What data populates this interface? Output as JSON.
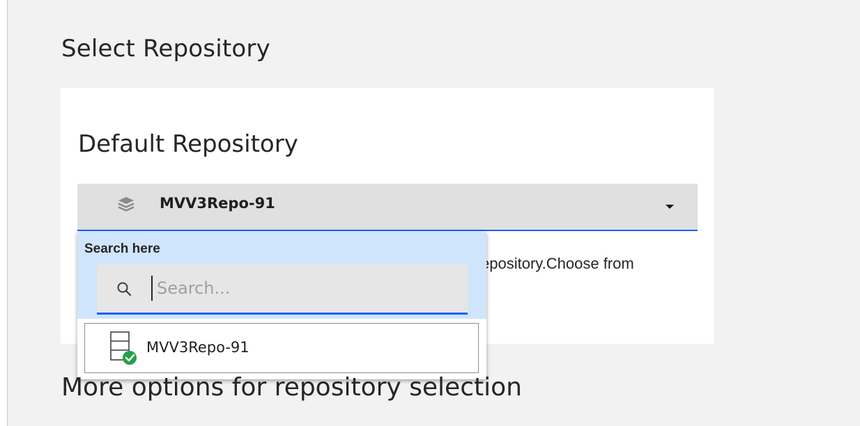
{
  "page": {
    "title": "Select Repository",
    "more_options": "More options for repository selection"
  },
  "card": {
    "title": "Default Repository",
    "helper_text": "epository.Choose from"
  },
  "select": {
    "value": "MVV3Repo-91",
    "icon": "stack-layers-icon",
    "caret_icon": "caret-down-icon"
  },
  "dropdown": {
    "search_label": "Search here",
    "search_placeholder": "Search...",
    "search_value": "",
    "search_icon": "search-icon",
    "options": [
      {
        "label": "MVV3Repo-91",
        "icon": "repository-connected-icon",
        "status": "connected"
      }
    ]
  },
  "colors": {
    "accent": "#0f62fe",
    "dropdown_header_bg": "#cfe5fb",
    "select_bg": "#e0e0e0",
    "status_green": "#24a148"
  }
}
